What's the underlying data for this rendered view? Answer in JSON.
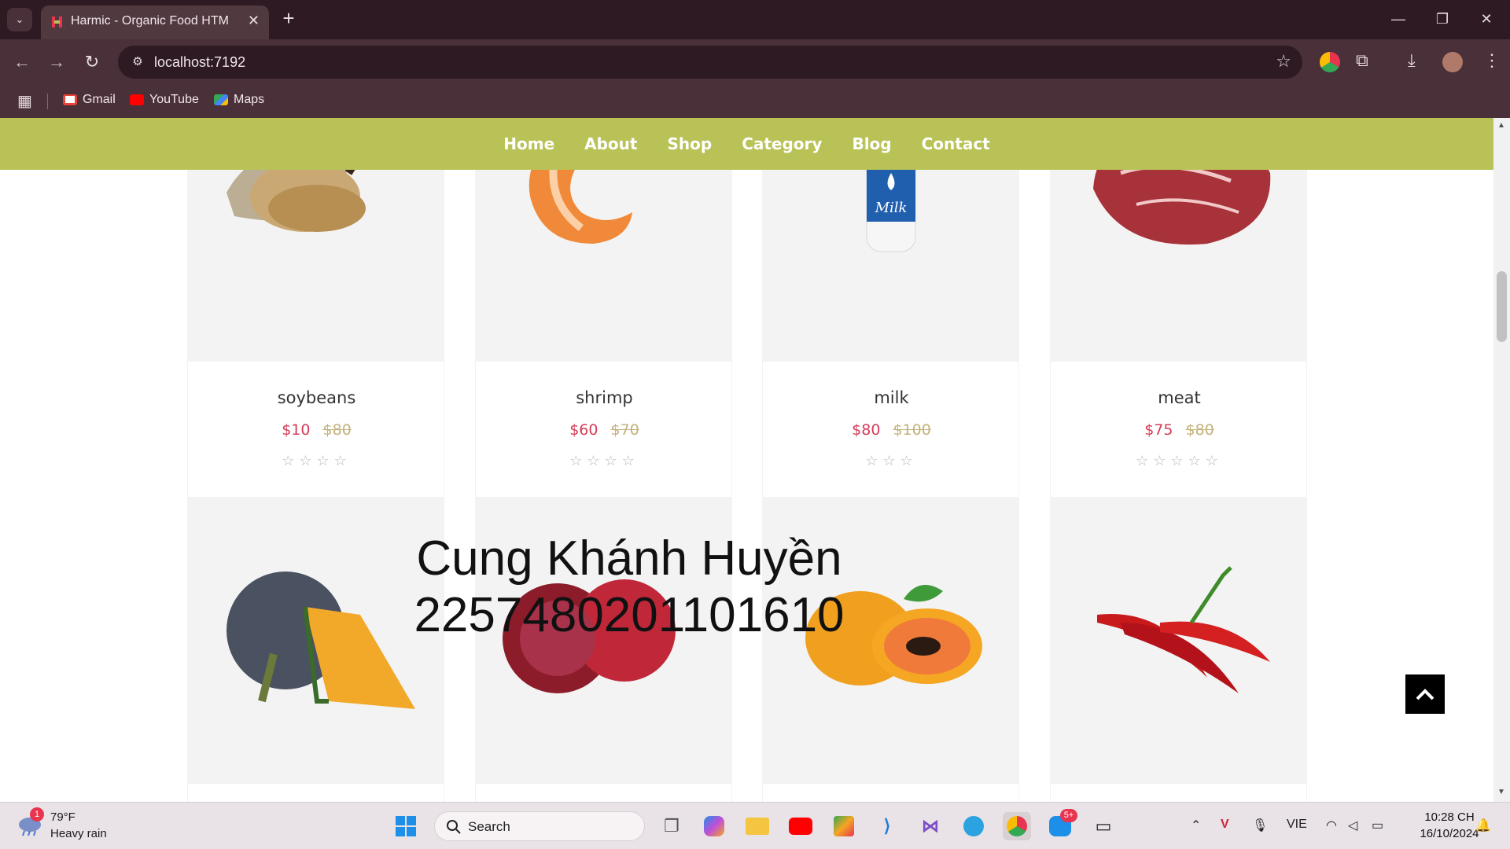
{
  "browser": {
    "tab_title": "Harmic - Organic Food HTML Te",
    "url": "localhost:7192",
    "bookmarks": [
      {
        "label": "Gmail",
        "color": "#ea4335"
      },
      {
        "label": "YouTube",
        "color": "#ff0000"
      },
      {
        "label": "Maps",
        "color": "#34a853"
      }
    ]
  },
  "nav": {
    "items": [
      "Home",
      "About",
      "Shop",
      "Category",
      "Blog",
      "Contact"
    ],
    "background": "#b9c257"
  },
  "products": [
    {
      "name": "soybeans",
      "price": "$10",
      "old_price": "$80",
      "rating_stars": 4,
      "image": "soybeans-sack"
    },
    {
      "name": "shrimp",
      "price": "$60",
      "old_price": "$70",
      "rating_stars": 4,
      "image": "shrimp"
    },
    {
      "name": "milk",
      "price": "$80",
      "old_price": "$100",
      "rating_stars": 3,
      "image": "milk-bottle"
    },
    {
      "name": "meat",
      "price": "$75",
      "old_price": "$80",
      "rating_stars": 5,
      "image": "raw-meat"
    }
  ],
  "products_row2": [
    {
      "image": "pumpkin"
    },
    {
      "image": "pomegranate"
    },
    {
      "image": "papaya"
    },
    {
      "image": "red-chili"
    }
  ],
  "watermark": {
    "line1": "Cung Khánh Huyền",
    "line2": "2257480201101610"
  },
  "taskbar": {
    "weather_temp": "79°F",
    "weather_desc": "Heavy rain",
    "weather_badge": "1",
    "search_label": "Search",
    "zalo_badge": "5+",
    "language": "VIE",
    "time": "10:28 CH",
    "date": "16/10/2024"
  },
  "colors": {
    "price_now": "#d43c57",
    "price_old": "#c4b27b",
    "browser_frame": "#4a3039"
  }
}
